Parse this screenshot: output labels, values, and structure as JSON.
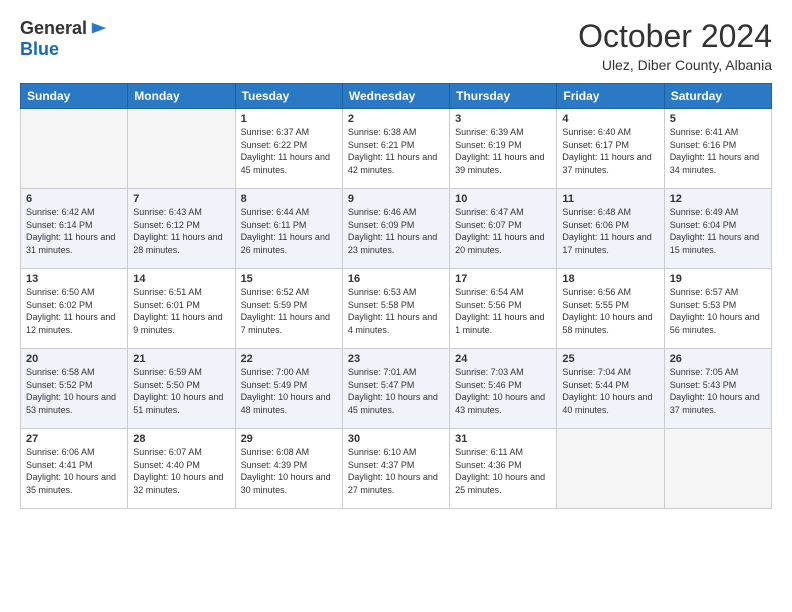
{
  "header": {
    "logo_general": "General",
    "logo_blue": "Blue",
    "month_title": "October 2024",
    "subtitle": "Ulez, Diber County, Albania"
  },
  "weekdays": [
    "Sunday",
    "Monday",
    "Tuesday",
    "Wednesday",
    "Thursday",
    "Friday",
    "Saturday"
  ],
  "days": [
    {
      "num": "",
      "sunrise": "",
      "sunset": "",
      "daylight": ""
    },
    {
      "num": "",
      "sunrise": "",
      "sunset": "",
      "daylight": ""
    },
    {
      "num": "1",
      "sunrise": "Sunrise: 6:37 AM",
      "sunset": "Sunset: 6:22 PM",
      "daylight": "Daylight: 11 hours and 45 minutes."
    },
    {
      "num": "2",
      "sunrise": "Sunrise: 6:38 AM",
      "sunset": "Sunset: 6:21 PM",
      "daylight": "Daylight: 11 hours and 42 minutes."
    },
    {
      "num": "3",
      "sunrise": "Sunrise: 6:39 AM",
      "sunset": "Sunset: 6:19 PM",
      "daylight": "Daylight: 11 hours and 39 minutes."
    },
    {
      "num": "4",
      "sunrise": "Sunrise: 6:40 AM",
      "sunset": "Sunset: 6:17 PM",
      "daylight": "Daylight: 11 hours and 37 minutes."
    },
    {
      "num": "5",
      "sunrise": "Sunrise: 6:41 AM",
      "sunset": "Sunset: 6:16 PM",
      "daylight": "Daylight: 11 hours and 34 minutes."
    },
    {
      "num": "6",
      "sunrise": "Sunrise: 6:42 AM",
      "sunset": "Sunset: 6:14 PM",
      "daylight": "Daylight: 11 hours and 31 minutes."
    },
    {
      "num": "7",
      "sunrise": "Sunrise: 6:43 AM",
      "sunset": "Sunset: 6:12 PM",
      "daylight": "Daylight: 11 hours and 28 minutes."
    },
    {
      "num": "8",
      "sunrise": "Sunrise: 6:44 AM",
      "sunset": "Sunset: 6:11 PM",
      "daylight": "Daylight: 11 hours and 26 minutes."
    },
    {
      "num": "9",
      "sunrise": "Sunrise: 6:46 AM",
      "sunset": "Sunset: 6:09 PM",
      "daylight": "Daylight: 11 hours and 23 minutes."
    },
    {
      "num": "10",
      "sunrise": "Sunrise: 6:47 AM",
      "sunset": "Sunset: 6:07 PM",
      "daylight": "Daylight: 11 hours and 20 minutes."
    },
    {
      "num": "11",
      "sunrise": "Sunrise: 6:48 AM",
      "sunset": "Sunset: 6:06 PM",
      "daylight": "Daylight: 11 hours and 17 minutes."
    },
    {
      "num": "12",
      "sunrise": "Sunrise: 6:49 AM",
      "sunset": "Sunset: 6:04 PM",
      "daylight": "Daylight: 11 hours and 15 minutes."
    },
    {
      "num": "13",
      "sunrise": "Sunrise: 6:50 AM",
      "sunset": "Sunset: 6:02 PM",
      "daylight": "Daylight: 11 hours and 12 minutes."
    },
    {
      "num": "14",
      "sunrise": "Sunrise: 6:51 AM",
      "sunset": "Sunset: 6:01 PM",
      "daylight": "Daylight: 11 hours and 9 minutes."
    },
    {
      "num": "15",
      "sunrise": "Sunrise: 6:52 AM",
      "sunset": "Sunset: 5:59 PM",
      "daylight": "Daylight: 11 hours and 7 minutes."
    },
    {
      "num": "16",
      "sunrise": "Sunrise: 6:53 AM",
      "sunset": "Sunset: 5:58 PM",
      "daylight": "Daylight: 11 hours and 4 minutes."
    },
    {
      "num": "17",
      "sunrise": "Sunrise: 6:54 AM",
      "sunset": "Sunset: 5:56 PM",
      "daylight": "Daylight: 11 hours and 1 minute."
    },
    {
      "num": "18",
      "sunrise": "Sunrise: 6:56 AM",
      "sunset": "Sunset: 5:55 PM",
      "daylight": "Daylight: 10 hours and 58 minutes."
    },
    {
      "num": "19",
      "sunrise": "Sunrise: 6:57 AM",
      "sunset": "Sunset: 5:53 PM",
      "daylight": "Daylight: 10 hours and 56 minutes."
    },
    {
      "num": "20",
      "sunrise": "Sunrise: 6:58 AM",
      "sunset": "Sunset: 5:52 PM",
      "daylight": "Daylight: 10 hours and 53 minutes."
    },
    {
      "num": "21",
      "sunrise": "Sunrise: 6:59 AM",
      "sunset": "Sunset: 5:50 PM",
      "daylight": "Daylight: 10 hours and 51 minutes."
    },
    {
      "num": "22",
      "sunrise": "Sunrise: 7:00 AM",
      "sunset": "Sunset: 5:49 PM",
      "daylight": "Daylight: 10 hours and 48 minutes."
    },
    {
      "num": "23",
      "sunrise": "Sunrise: 7:01 AM",
      "sunset": "Sunset: 5:47 PM",
      "daylight": "Daylight: 10 hours and 45 minutes."
    },
    {
      "num": "24",
      "sunrise": "Sunrise: 7:03 AM",
      "sunset": "Sunset: 5:46 PM",
      "daylight": "Daylight: 10 hours and 43 minutes."
    },
    {
      "num": "25",
      "sunrise": "Sunrise: 7:04 AM",
      "sunset": "Sunset: 5:44 PM",
      "daylight": "Daylight: 10 hours and 40 minutes."
    },
    {
      "num": "26",
      "sunrise": "Sunrise: 7:05 AM",
      "sunset": "Sunset: 5:43 PM",
      "daylight": "Daylight: 10 hours and 37 minutes."
    },
    {
      "num": "27",
      "sunrise": "Sunrise: 6:06 AM",
      "sunset": "Sunset: 4:41 PM",
      "daylight": "Daylight: 10 hours and 35 minutes."
    },
    {
      "num": "28",
      "sunrise": "Sunrise: 6:07 AM",
      "sunset": "Sunset: 4:40 PM",
      "daylight": "Daylight: 10 hours and 32 minutes."
    },
    {
      "num": "29",
      "sunrise": "Sunrise: 6:08 AM",
      "sunset": "Sunset: 4:39 PM",
      "daylight": "Daylight: 10 hours and 30 minutes."
    },
    {
      "num": "30",
      "sunrise": "Sunrise: 6:10 AM",
      "sunset": "Sunset: 4:37 PM",
      "daylight": "Daylight: 10 hours and 27 minutes."
    },
    {
      "num": "31",
      "sunrise": "Sunrise: 6:11 AM",
      "sunset": "Sunset: 4:36 PM",
      "daylight": "Daylight: 10 hours and 25 minutes."
    }
  ]
}
